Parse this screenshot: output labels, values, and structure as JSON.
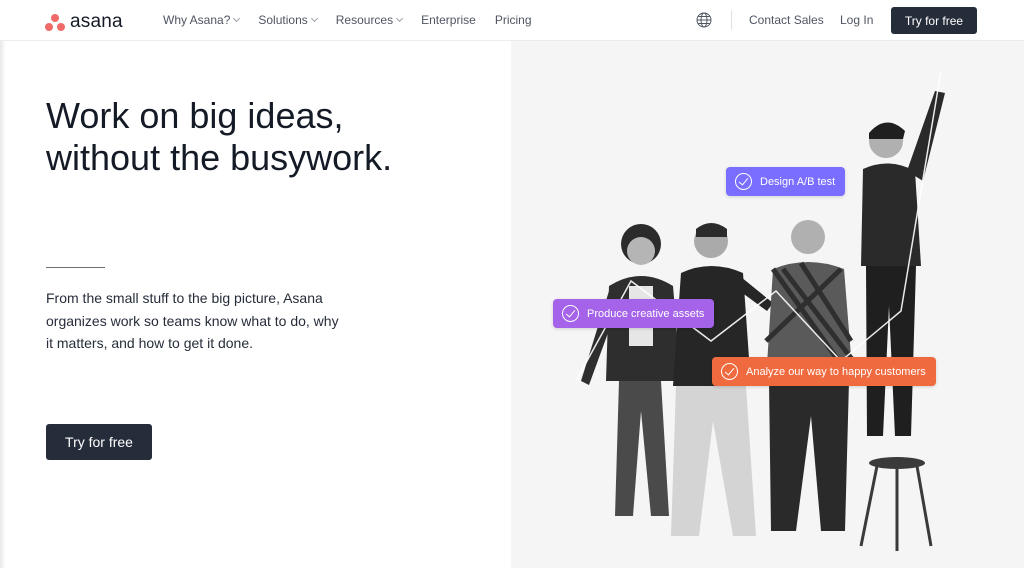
{
  "brand": {
    "name": "asana",
    "color": "#f06a6a"
  },
  "nav": {
    "items": [
      {
        "label": "Why Asana?",
        "dropdown": true
      },
      {
        "label": "Solutions",
        "dropdown": true
      },
      {
        "label": "Resources",
        "dropdown": true
      },
      {
        "label": "Enterprise",
        "dropdown": false
      },
      {
        "label": "Pricing",
        "dropdown": false
      }
    ],
    "globe_icon": "globe-icon",
    "contact_sales": "Contact Sales",
    "log_in": "Log In",
    "try_free": "Try for free"
  },
  "hero": {
    "title_line1": "Work on big ideas,",
    "title_line2": "without the busywork.",
    "description": "From the small stuff to the big picture, Asana organizes work so teams know what to do, why it matters, and how to get it done.",
    "cta": "Try for free"
  },
  "image": {
    "tags": [
      {
        "label": "Design A/B test",
        "color": "#796eff"
      },
      {
        "label": "Produce creative assets",
        "color": "#a463e8"
      },
      {
        "label": "Analyze our way to happy customers",
        "color": "#f06a3f"
      }
    ]
  },
  "colors": {
    "dark": "#262d3a",
    "text": "#151b26"
  }
}
